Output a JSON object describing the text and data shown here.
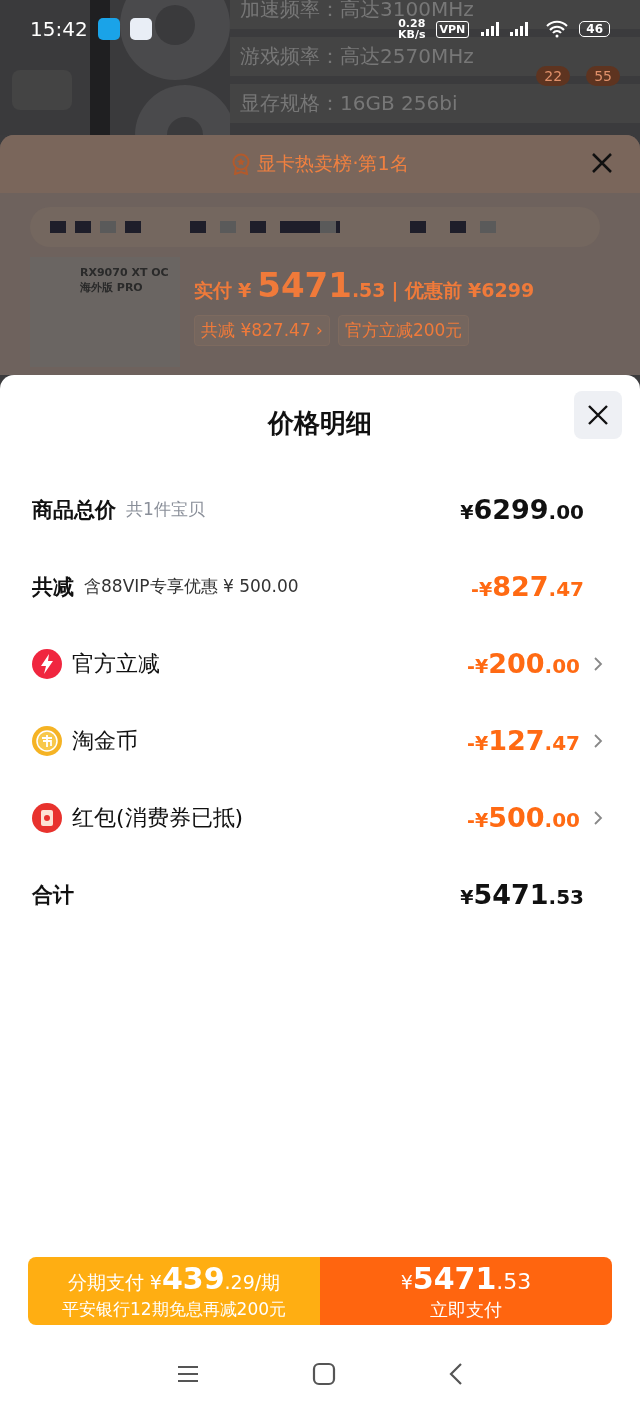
{
  "status_bar": {
    "time": "15:42",
    "net_speed": "0.28",
    "net_unit": "KB/s",
    "vpn": "VPN",
    "battery": "46"
  },
  "background_page": {
    "specs": [
      "加速频率：高达3100MHz",
      "游戏频率：高达2570MHz",
      "显存规格：16GB 256bi"
    ],
    "badges": [
      "22",
      "55"
    ]
  },
  "rank_sheet": {
    "title": "显卡热卖榜·第1名",
    "product_name": "RX9070 XT OC 海外版 PRO",
    "pay_label": "实付",
    "pay_currency": "¥",
    "pay_amount": "5471",
    "pay_decimal": ".53",
    "separator": "|",
    "original_price": "优惠前 ¥6299",
    "tags": [
      {
        "text": "共减 ¥827.47",
        "arrow": "›"
      },
      {
        "text": "官方立减200元"
      }
    ]
  },
  "price_sheet": {
    "title": "价格明细",
    "rows": [
      {
        "kind": "plain",
        "label": "商品总价",
        "note": "共1件宝贝",
        "prefix": "¥",
        "integer": "6299",
        "decimal": ".00",
        "discount": false,
        "expandable": false
      },
      {
        "kind": "plain",
        "label": "共减",
        "note": "含88VIP专享优惠 ¥ 500.00",
        "prefix": "-¥",
        "integer": "827",
        "decimal": ".47",
        "discount": true,
        "expandable": false
      },
      {
        "kind": "bolt",
        "label": "官方立减",
        "prefix": "-¥",
        "integer": "200",
        "decimal": ".00",
        "discount": true,
        "expandable": true
      },
      {
        "kind": "coin",
        "label": "淘金币",
        "prefix": "-¥",
        "integer": "127",
        "decimal": ".47",
        "discount": true,
        "expandable": true
      },
      {
        "kind": "envelope",
        "label": "红包(消费券已抵)",
        "prefix": "-¥",
        "integer": "500",
        "decimal": ".00",
        "discount": true,
        "expandable": true
      },
      {
        "kind": "plain",
        "label": "合计",
        "prefix": "¥",
        "integer": "5471",
        "decimal": ".53",
        "discount": false,
        "expandable": false
      }
    ]
  },
  "pay_bar": {
    "installment": {
      "label": "分期支付",
      "prefix": "¥",
      "integer": "439",
      "decimal": ".29/期",
      "note": "平安银行12期免息再减200元"
    },
    "pay_now": {
      "prefix": "¥",
      "integer": "5471",
      "decimal": ".53",
      "label": "立即支付"
    }
  }
}
